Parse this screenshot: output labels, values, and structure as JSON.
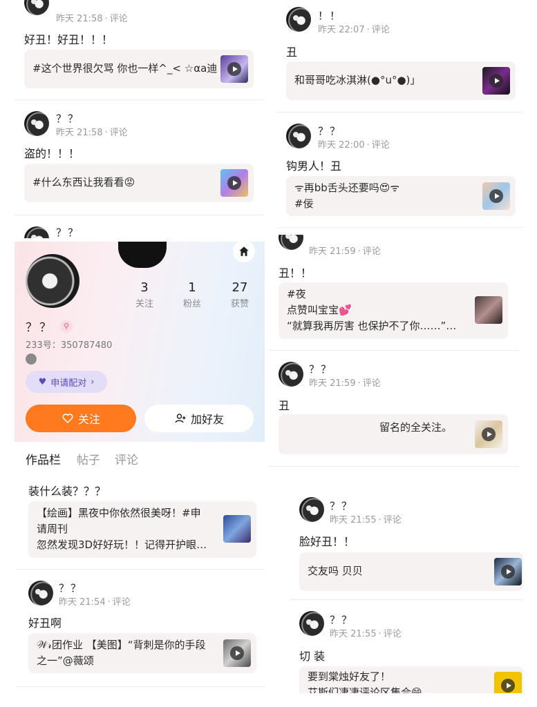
{
  "colors": {
    "accent": "#ff7a1f",
    "pair": "#5b4bb8",
    "meta": "#9a9a9a"
  },
  "left_top": {
    "posts": [
      {
        "meta_time": "昨天 21:58",
        "meta_comment": "评论",
        "text": "好丑！好丑！！！",
        "quote": "#这个世界很欠骂 你也一样^_< ☆αa迪"
      },
      {
        "nick": "？？",
        "meta_time": "昨天 21:58",
        "meta_comment": "评论",
        "text": "盗的！！！",
        "quote": "#什么东西让我看看😡"
      },
      {
        "nick": "？？"
      }
    ]
  },
  "profile": {
    "name": "？？",
    "id_text": "233号：350787480",
    "stats": [
      {
        "num": "3",
        "label": "关注"
      },
      {
        "num": "1",
        "label": "粉丝"
      },
      {
        "num": "27",
        "label": "获赞"
      }
    ],
    "pair_label": "申请配对",
    "follow_label": "关注",
    "add_friend_label": "加好友",
    "tabs": [
      "作品栏",
      "帖子",
      "评论"
    ]
  },
  "left_bottom": {
    "posts": [
      {
        "text": "装什么装？？？",
        "quote_lines": [
          "【绘画】黑夜中你依然很美呀！#申",
          "请周刊",
          "忽然发现3D好好玩！！记得开护眼…"
        ]
      },
      {
        "nick": "？？",
        "meta_time": "昨天 21:54",
        "meta_comment": "评论",
        "text": "好丑啊",
        "quote_lines": [
          "𝒲𝓇团作业 【美图】“背刺是你的手段",
          "之一”@薇颂"
        ]
      }
    ]
  },
  "right_top": {
    "posts": [
      {
        "nick": "！！",
        "meta_time": "昨天 22:07",
        "meta_comment": "评论",
        "text": "丑",
        "quote": "和哥哥吃冰淇淋(●°u°●)」"
      },
      {
        "nick": "？？",
        "meta_time": "昨天 22:00",
        "meta_comment": "评论",
        "text": "钩男人！丑",
        "quote_lines": [
          "ᯤ再bb舌头还要吗😍ᯤ",
          "#佞"
        ]
      }
    ]
  },
  "right_mid": {
    "posts": [
      {
        "meta_time": "昨天 21:59",
        "meta_comment": "评论",
        "text": "丑！！",
        "quote_lines": [
          "#夜",
          "点赞叫宝宝💕",
          "“就算我再厉害  也保护不了你……”…"
        ]
      },
      {
        "nick": "？？",
        "meta_time": "昨天 21:59",
        "meta_comment": "评论",
        "text": "丑",
        "quote": "留名的全关注。"
      }
    ]
  },
  "right_bottom": {
    "posts": [
      {
        "nick": "？？",
        "meta_time": "昨天 21:55",
        "meta_comment": "评论",
        "text": "脸好丑！！",
        "quote": "交友吗 贝贝"
      },
      {
        "nick": "？？",
        "meta_time": "昨天 21:55",
        "meta_comment": "评论",
        "text": "切 装",
        "quote_lines": [
          "要到棠烛好友了！",
          "艾斯们凄凄评论区集合😄"
        ]
      }
    ]
  }
}
